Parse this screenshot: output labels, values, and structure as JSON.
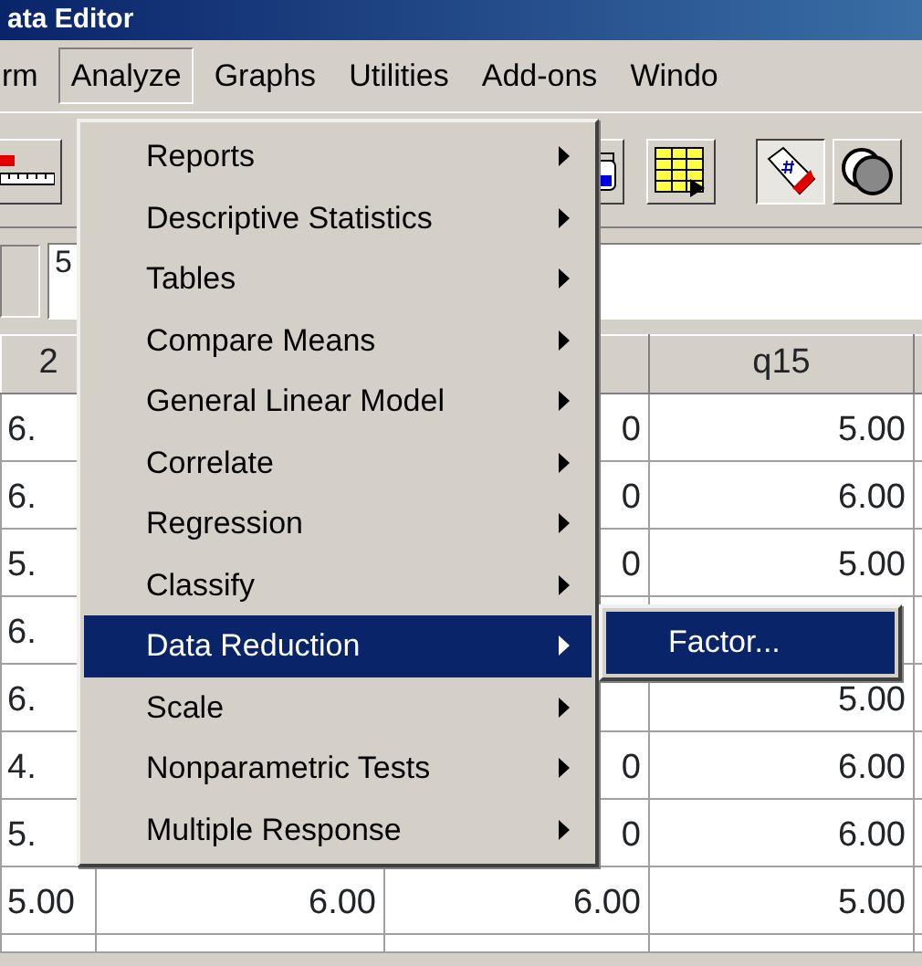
{
  "window": {
    "title": "ata Editor"
  },
  "menu_bar": [
    {
      "label": "rm",
      "selected": false
    },
    {
      "label": "Analyze",
      "selected": true
    },
    {
      "label": "Graphs",
      "selected": false
    },
    {
      "label": "Utilities",
      "selected": false
    },
    {
      "label": "Add-ons",
      "selected": false
    },
    {
      "label": "Windo",
      "selected": false
    }
  ],
  "toolbar": {
    "buttons": [
      {
        "kind": "ruler",
        "pressed": false
      },
      {
        "kind": "jar",
        "pressed": false
      },
      {
        "kind": "grid",
        "pressed": false
      },
      {
        "kind": "tag",
        "pressed": true
      },
      {
        "kind": "circles",
        "pressed": false
      }
    ]
  },
  "cell_editor": {
    "value": "5"
  },
  "table": {
    "columns": [
      "2",
      null,
      null,
      "q15"
    ],
    "rows": [
      {
        "cells": [
          "6.",
          null,
          "0",
          "5.00"
        ]
      },
      {
        "cells": [
          "6.",
          null,
          "0",
          "6.00"
        ]
      },
      {
        "cells": [
          "5.",
          null,
          "0",
          "5.00"
        ]
      },
      {
        "cells": [
          "6.",
          null,
          null,
          null
        ]
      },
      {
        "cells": [
          "6.",
          null,
          null,
          "5.00"
        ]
      },
      {
        "cells": [
          "4.",
          null,
          "0",
          "6.00"
        ]
      },
      {
        "cells": [
          "5.",
          null,
          "0",
          "6.00"
        ]
      },
      {
        "cells": [
          "5.00",
          "6.00",
          "6.00",
          "5.00"
        ]
      }
    ]
  },
  "analyze_menu": {
    "items": [
      {
        "label": "Reports",
        "submenu": true,
        "selected": false
      },
      {
        "label": "Descriptive Statistics",
        "submenu": true,
        "selected": false
      },
      {
        "label": "Tables",
        "submenu": true,
        "selected": false
      },
      {
        "label": "Compare Means",
        "submenu": true,
        "selected": false
      },
      {
        "label": "General Linear Model",
        "submenu": true,
        "selected": false
      },
      {
        "label": "Correlate",
        "submenu": true,
        "selected": false
      },
      {
        "label": "Regression",
        "submenu": true,
        "selected": false
      },
      {
        "label": "Classify",
        "submenu": true,
        "selected": false
      },
      {
        "label": "Data Reduction",
        "submenu": true,
        "selected": true
      },
      {
        "label": "Scale",
        "submenu": true,
        "selected": false
      },
      {
        "label": "Nonparametric Tests",
        "submenu": true,
        "selected": false
      },
      {
        "label": "Multiple Response",
        "submenu": true,
        "selected": false
      }
    ]
  },
  "submenu": {
    "items": [
      {
        "label": "Factor...",
        "selected": true
      }
    ]
  }
}
